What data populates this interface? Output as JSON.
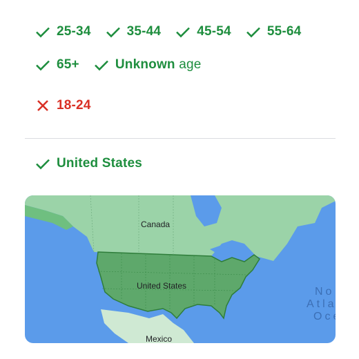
{
  "age_ranges": {
    "included": [
      "25-34",
      "35-44",
      "45-54",
      "55-64",
      "65+"
    ],
    "unknown": {
      "bold": "Unknown",
      "suffix": " age"
    },
    "excluded": [
      "18-24"
    ]
  },
  "location": {
    "included": "United States"
  },
  "map": {
    "labels": {
      "canada": "Canada",
      "usa": "United States",
      "mexico": "Mexico"
    },
    "ocean_lines": [
      "No",
      "Atla",
      "Oce"
    ]
  },
  "colors": {
    "included": "#1e8e3e",
    "excluded": "#d93025",
    "water": "#5b9bea",
    "land": "#9bd3a8",
    "usa_fill": "#5ea86b"
  },
  "icons": {
    "included": "check-icon",
    "excluded": "close-icon"
  }
}
